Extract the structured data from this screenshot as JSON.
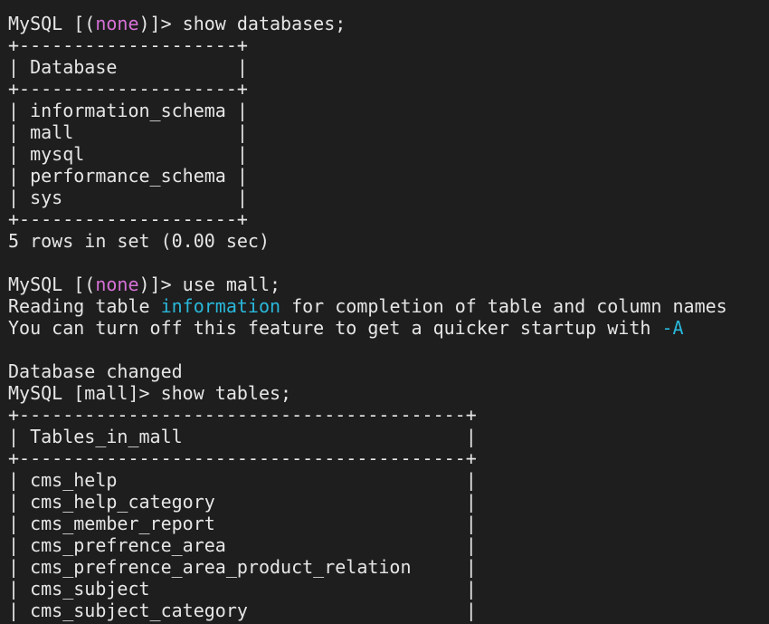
{
  "colors": {
    "background": "#1e1e1e",
    "foreground": "#e6e6e6",
    "prompt_highlight": "#d670d6",
    "keyword_highlight": "#29b8db"
  },
  "terminal": {
    "lines": [
      [
        {
          "t": "MySQL ["
        },
        {
          "t": "(",
          "c": ""
        },
        {
          "t": "none",
          "c": "magenta"
        },
        {
          "t": ")]> show databases;"
        }
      ],
      [
        {
          "t": "+--------------------+"
        }
      ],
      [
        {
          "t": "| Database           |"
        }
      ],
      [
        {
          "t": "+--------------------+"
        }
      ],
      [
        {
          "t": "| information_schema |"
        }
      ],
      [
        {
          "t": "| mall               |"
        }
      ],
      [
        {
          "t": "| mysql              |"
        }
      ],
      [
        {
          "t": "| performance_schema |"
        }
      ],
      [
        {
          "t": "| sys                |"
        }
      ],
      [
        {
          "t": "+--------------------+"
        }
      ],
      [
        {
          "t": "5 rows in set (0.00 sec)"
        }
      ],
      [
        {
          "t": ""
        }
      ],
      [
        {
          "t": "MySQL [("
        },
        {
          "t": "none",
          "c": "magenta"
        },
        {
          "t": ")]> use mall;"
        }
      ],
      [
        {
          "t": "Reading table "
        },
        {
          "t": "information",
          "c": "cyan"
        },
        {
          "t": " for completion of table and column names"
        }
      ],
      [
        {
          "t": "You can turn off this feature to get a quicker startup with "
        },
        {
          "t": "-A",
          "c": "cyan"
        }
      ],
      [
        {
          "t": ""
        }
      ],
      [
        {
          "t": "Database changed"
        }
      ],
      [
        {
          "t": "MySQL [mall]> show tables;"
        }
      ],
      [
        {
          "t": "+-----------------------------------------+"
        }
      ],
      [
        {
          "t": "| Tables_in_mall                          |"
        }
      ],
      [
        {
          "t": "+-----------------------------------------+"
        }
      ],
      [
        {
          "t": "| cms_help                                |"
        }
      ],
      [
        {
          "t": "| cms_help_category                       |"
        }
      ],
      [
        {
          "t": "| cms_member_report                       |"
        }
      ],
      [
        {
          "t": "| cms_prefrence_area                      |"
        }
      ],
      [
        {
          "t": "| cms_prefrence_area_product_relation     |"
        }
      ],
      [
        {
          "t": "| cms_subject                             |"
        }
      ],
      [
        {
          "t": "| cms_subject_category                    |"
        }
      ]
    ]
  }
}
